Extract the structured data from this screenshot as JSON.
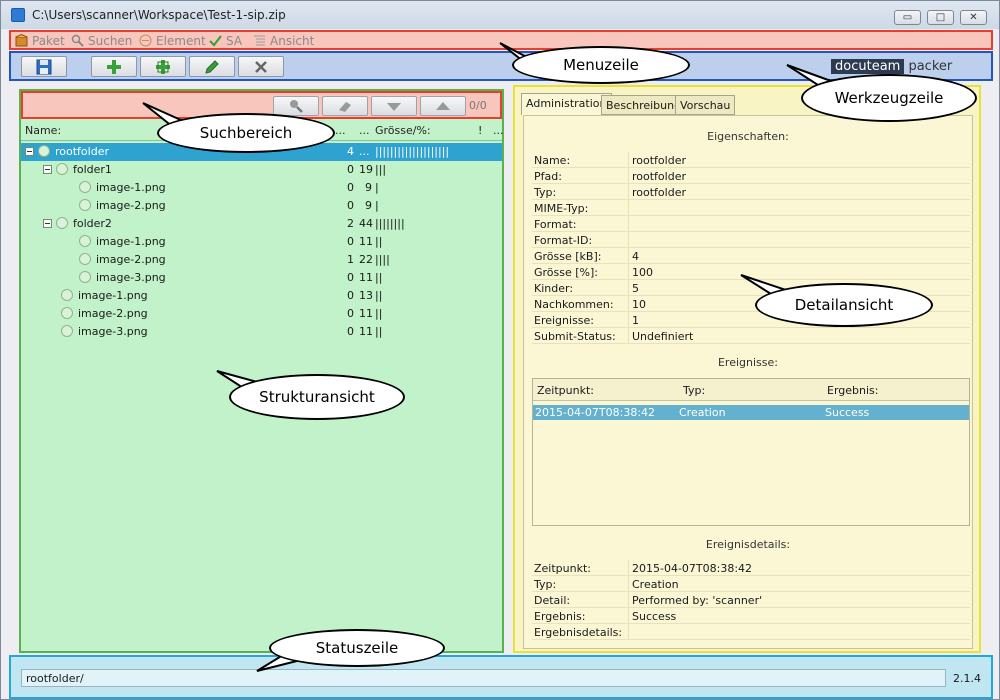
{
  "window": {
    "title": "C:\\Users\\scanner\\Workspace\\Test-1-sip.zip",
    "minimize": "▭",
    "maximize": "□",
    "close": "✕"
  },
  "menu": {
    "items": [
      "Paket",
      "Suchen",
      "Element",
      "SA",
      "Ansicht"
    ]
  },
  "brand": {
    "dark": "docuteam",
    "light": "packer"
  },
  "search": {
    "count": "0/0"
  },
  "tree": {
    "headers": {
      "name": "Name:",
      "col2": "...",
      "col3": "...",
      "size": "Grösse/%:",
      "col5": "!",
      "col6": "..."
    },
    "rows": [
      {
        "name": "rootfolder",
        "a": "4",
        "b": "...",
        "bars": "||||||||||||||||||||"
      },
      {
        "name": "folder1",
        "a": "0",
        "b": "19",
        "bars": "|||"
      },
      {
        "name": "image-1.png",
        "a": "0",
        "b": "9",
        "bars": "|"
      },
      {
        "name": "image-2.png",
        "a": "0",
        "b": "9",
        "bars": "|"
      },
      {
        "name": "folder2",
        "a": "2",
        "b": "44",
        "bars": "||||||||"
      },
      {
        "name": "image-1.png",
        "a": "0",
        "b": "11",
        "bars": "||"
      },
      {
        "name": "image-2.png",
        "a": "1",
        "b": "22",
        "bars": "||||"
      },
      {
        "name": "image-3.png",
        "a": "0",
        "b": "11",
        "bars": "||"
      },
      {
        "name": "image-1.png",
        "a": "0",
        "b": "13",
        "bars": "||"
      },
      {
        "name": "image-2.png",
        "a": "0",
        "b": "11",
        "bars": "||"
      },
      {
        "name": "image-3.png",
        "a": "0",
        "b": "11",
        "bars": "||"
      }
    ]
  },
  "detail": {
    "tabs": [
      "Administration",
      "Beschreibung",
      "Vorschau"
    ],
    "properties_title": "Eigenschaften:",
    "properties": [
      {
        "k": "Name:",
        "v": "rootfolder"
      },
      {
        "k": "Pfad:",
        "v": "rootfolder"
      },
      {
        "k": "Typ:",
        "v": "rootfolder"
      },
      {
        "k": "MIME-Typ:",
        "v": ""
      },
      {
        "k": "Format:",
        "v": ""
      },
      {
        "k": "Format-ID:",
        "v": ""
      },
      {
        "k": "Grösse [kB]:",
        "v": "4"
      },
      {
        "k": "Grösse [%]:",
        "v": "100"
      },
      {
        "k": "Kinder:",
        "v": "5"
      },
      {
        "k": "Nachkommen:",
        "v": "10"
      },
      {
        "k": "Ereignisse:",
        "v": "1"
      },
      {
        "k": "Submit-Status:",
        "v": "Undefiniert"
      }
    ],
    "events_title": "Ereignisse:",
    "events_headers": [
      "Zeitpunkt:",
      "Typ:",
      "Ergebnis:"
    ],
    "events": [
      {
        "time": "2015-04-07T08:38:42",
        "type": "Creation",
        "result": "Success"
      }
    ],
    "event_details_title": "Ereignisdetails:",
    "event_details": [
      {
        "k": "Zeitpunkt:",
        "v": "2015-04-07T08:38:42"
      },
      {
        "k": "Typ:",
        "v": "Creation"
      },
      {
        "k": "Detail:",
        "v": "Performed by: 'scanner'"
      },
      {
        "k": "Ergebnis:",
        "v": "Success"
      },
      {
        "k": "Ergebnisdetails:",
        "v": ""
      }
    ]
  },
  "status": {
    "path": "rootfolder/",
    "version": "2.1.4"
  },
  "callouts": {
    "menuzeile": "Menuzeile",
    "werkzeugzeile": "Werkzeugzeile",
    "suchbereich": "Suchbereich",
    "detailansicht": "Detailansicht",
    "strukturansicht": "Strukturansicht",
    "statuszeile": "Statuszeile"
  },
  "colors": {
    "menu_highlight": "#e5402b",
    "toolbar_highlight": "#2256b8",
    "tree_highlight": "#58b24d",
    "detail_highlight": "#e8e136",
    "status_highlight": "#23a6d8",
    "selection": "#2ea3cf"
  }
}
